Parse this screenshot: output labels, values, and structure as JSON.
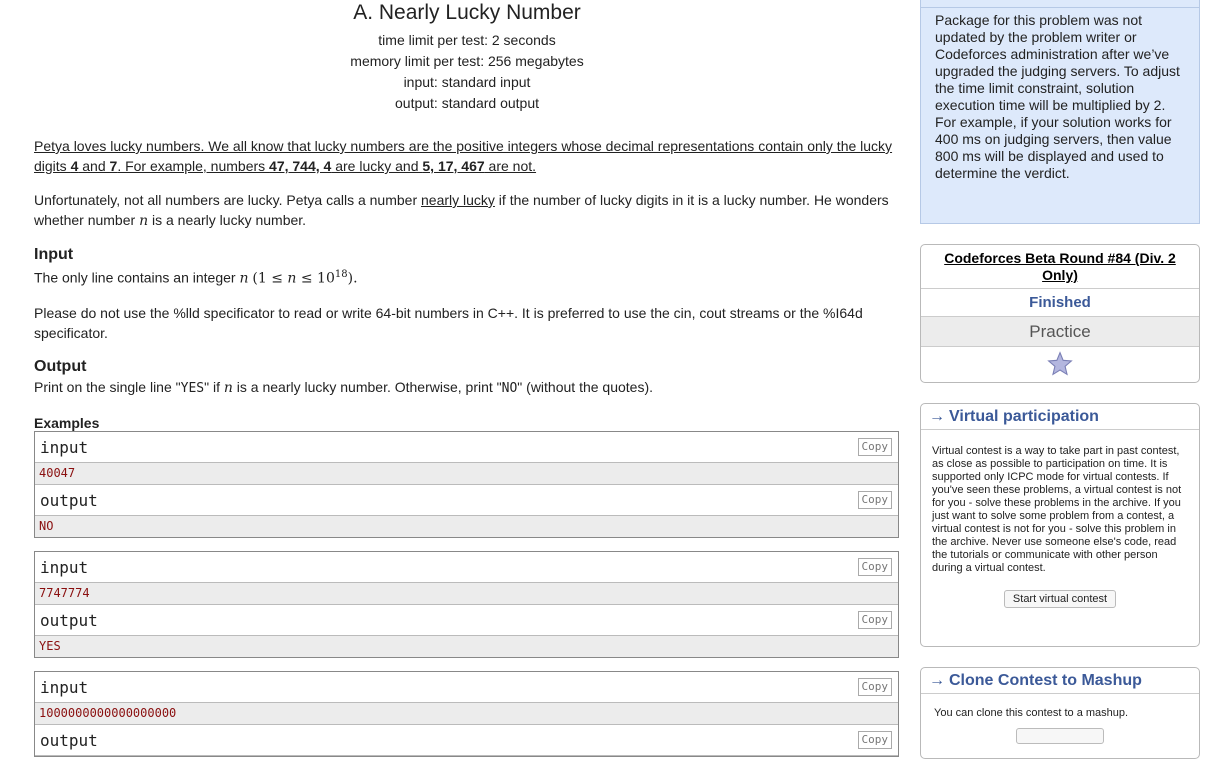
{
  "problem": {
    "title": "A. Nearly Lucky Number",
    "limits": [
      "time limit per test: 2 seconds",
      "memory limit per test: 256 megabytes",
      "input: standard input",
      "output: standard output"
    ],
    "statement_p1_part1": "Petya loves lucky numbers. We all know that lucky numbers are the positive integers whose decimal representations contain only the lucky digits ",
    "digit4": "4",
    "and": " and ",
    "digit7": "7",
    "statement_p1_part2": ". For example, numbers ",
    "lucky_examples": "47, 744, 4",
    "are_lucky": " are lucky and ",
    "unlucky_examples": "5, 17, 467",
    "are_not": " are not.",
    "p2_part1": "Unfortunately, not all numbers are lucky. Petya calls a number ",
    "nearly_lucky": "nearly lucky",
    "p2_part2": " if the number of lucky digits in it is a lucky number. He wonders whether number ",
    "var_n": "n",
    "p2_part3": " is a nearly lucky number.",
    "input_head": "Input",
    "input_text1": "The only line contains an integer ",
    "input_bound_open": "(1 ≤ ",
    "input_bound_mid": " ≤ 10",
    "input_bound_exp": "18",
    "input_bound_close": ").",
    "note": "Please do not use the %lld specificator to read or write 64-bit numbers in C++. It is preferred to use the cin, cout streams or the %I64d specificator.",
    "output_head": "Output",
    "output_text1": "Print on the single line \"",
    "yes": "YES",
    "output_text2": "\" if ",
    "output_text3": " is a nearly lucky number. Otherwise, print \"",
    "no": "NO",
    "output_text4": "\" (without the quotes).",
    "examples_head": "Examples",
    "input_label": "input",
    "output_label": "output",
    "copy_label": "Copy",
    "examples": [
      {
        "input": "40047",
        "output": "NO"
      },
      {
        "input": "7747774",
        "output": "YES"
      },
      {
        "input": "1000000000000000000",
        "output": ""
      }
    ]
  },
  "sidebar": {
    "notice": "Package for this problem was not updated by the problem writer or Codeforces administration after we’ve upgraded the judging servers. To adjust the time limit constraint, solution execution time will be multiplied by 2. For example, if your solution works for 400 ms on judging servers, then value 800 ms will be displayed and used to determine the verdict.",
    "contest_name": "Codeforces Beta Round #84 (Div. 2 Only)",
    "phase": "Finished",
    "practice": "Practice",
    "star_icon": "star-icon",
    "virtual_head": "Virtual participation",
    "virtual_text": "Virtual contest is a way to take part in past contest, as close as possible to participation on time. It is supported only ICPC mode for virtual contests. If you've seen these problems, a virtual contest is not for you - solve these problems in the archive. If you just want to solve some problem from a contest, a virtual contest is not for you - solve this problem in the archive. Never use someone else's code, read the tutorials or communicate with other person during a virtual contest.",
    "virtual_button": "Start virtual contest",
    "clone_head": "Clone Contest to Mashup",
    "clone_text": "You can clone this contest to a mashup.",
    "arrow": "→",
    "accent_color": "#3b5998",
    "notice_bg": "#dde9fb"
  }
}
